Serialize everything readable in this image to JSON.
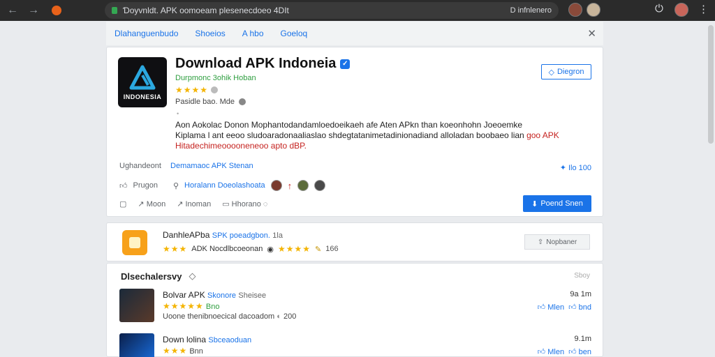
{
  "browser": {
    "url": "Ɗoyvnldt. APK oomoeam plesenecdoeo 4DIt",
    "url_right": "D infnlenero",
    "colors": {
      "chrome": "#2b2b2b",
      "accent": "#1a73e8",
      "green": "#2e9e3f",
      "star": "#f4b400"
    }
  },
  "tabs": [
    "Dlahanguenbudo",
    "Shoeios",
    "A hbo",
    "Goeloq"
  ],
  "app": {
    "title": "Download  APK Indoneia",
    "logo_text": "INDONESIA",
    "subtitle": "Durpmonc 3ohik Hoban",
    "stars": "★★★★",
    "meta": "Pasidle bao. Mde",
    "desc_lines": [
      "Aon Aokolac Donon Mophantodandamloedoeikaeh afe Aten APkn than koeonhohn Joeoemke",
      "Kiplama l ant eeoo sludoaradonaaliaslao shdegtatanimetadinionadiand alloladan boobaeo lian"
    ],
    "desc_red_end": "goo APK",
    "desc_red_line": "Hitadechimeooooneneoo apto dBP.",
    "follow_label": "Diegron",
    "dev_label": "Ughandeont",
    "dev_link": "Demamaoc APK Stenan",
    "dev_right": "Ilo 100",
    "likes_label": "Prugon",
    "community_link": "Horalann Doeolashoata",
    "actions": [
      "Moon",
      "Inoman",
      "Hhorano"
    ],
    "primary_label": "Poend Snen"
  },
  "suggested": {
    "title": "DanhleAPba",
    "title_link": "SPK poeadgbon.",
    "title_num": "1la",
    "stars_left": "★★★",
    "meta": "ADK Nocdlbcoeonan",
    "stars_right": "★★★★",
    "count": "166",
    "button_label": "Nopbaner"
  },
  "list": {
    "header": "Dlsechalersvy",
    "header_right": "Sboy",
    "items": [
      {
        "title": "Bolvar APK",
        "title_link": "Skonore",
        "title_tail": "Sheisee",
        "stars": "★★★★★",
        "stars_label": "Bno",
        "meta": "Uoone thenibnoecical dacoadom",
        "meta_num": "200",
        "size": "9a 1m",
        "action_1": "Mlen",
        "action_2": "bnd"
      },
      {
        "title": "Down lolina",
        "title_link": "Sbceaoduan",
        "title_tail": "",
        "stars": "★★★",
        "stars_label": "Bnn",
        "meta": "",
        "meta_num": "",
        "size": "9.1m",
        "action_1": "Mlen",
        "action_2": "ben"
      }
    ]
  }
}
